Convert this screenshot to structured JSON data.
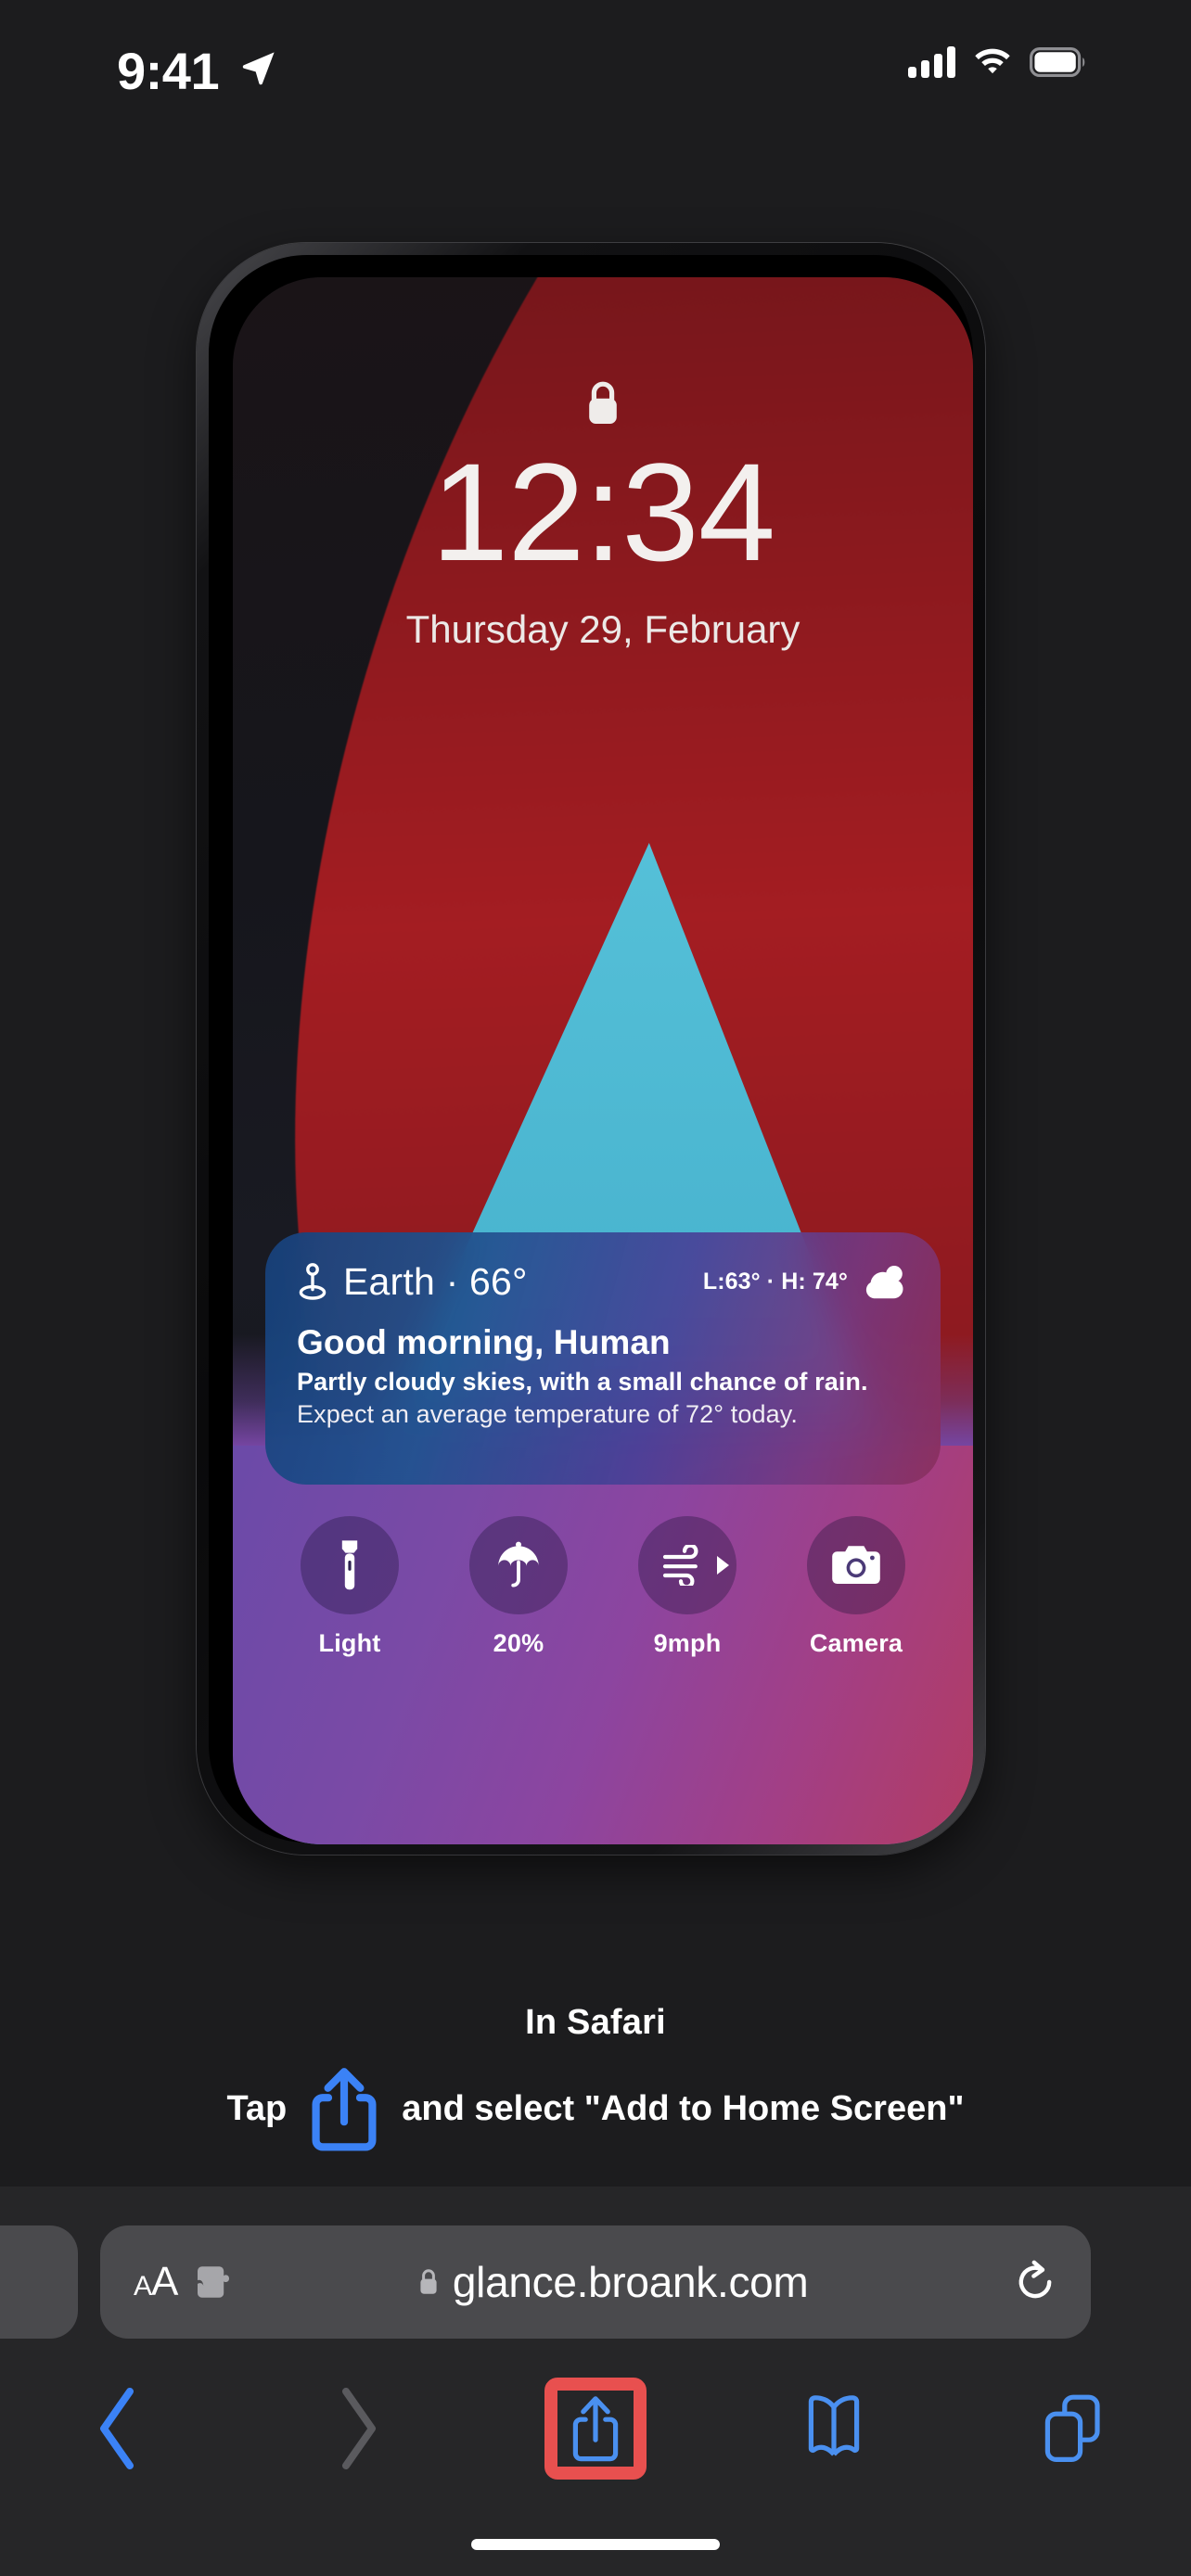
{
  "status_bar": {
    "time": "9:41",
    "location_icon": "location-arrow-icon",
    "signal_icon": "cellular-signal-icon",
    "wifi_icon": "wifi-icon",
    "battery_icon": "battery-full-icon"
  },
  "phone_preview": {
    "lock_icon": "lock-icon",
    "time": "12:34",
    "date": "Thursday 29, February",
    "weather_widget": {
      "location_icon": "location-pin-icon",
      "place_and_temp": "Earth · 66°",
      "high_low": "L:63° · H: 74°",
      "condition_icon": "sun-behind-cloud-icon",
      "greeting": "Good morning, Human",
      "summary": "Partly cloudy skies, with a small chance of rain.",
      "detail": "Expect an average temperature of 72° today."
    },
    "quick_actions": [
      {
        "icon": "flashlight-icon",
        "label": "Light"
      },
      {
        "icon": "umbrella-icon",
        "label": "20%"
      },
      {
        "icon": "wind-icon",
        "label": "9mph",
        "has_arrow": true
      },
      {
        "icon": "camera-icon",
        "label": "Camera"
      }
    ]
  },
  "instructions": {
    "title": "In Safari",
    "before_icon": "Tap",
    "share_icon": "share-icon",
    "after_icon": "and select \"Add to Home Screen\""
  },
  "safari": {
    "text_size_small": "A",
    "text_size_large": "A",
    "extensions_icon": "puzzle-piece-icon",
    "lock_icon": "lock-icon",
    "url": "glance.broank.com",
    "reload_icon": "reload-icon",
    "toolbar": [
      {
        "icon": "back-chevron-icon",
        "enabled": true
      },
      {
        "icon": "forward-chevron-icon",
        "enabled": false
      },
      {
        "icon": "share-icon",
        "highlighted": true
      },
      {
        "icon": "bookmarks-book-icon",
        "enabled": true
      },
      {
        "icon": "tabs-icon",
        "enabled": true
      }
    ],
    "home_indicator": "home-indicator"
  },
  "colors": {
    "page_background": "#1c1c1e",
    "safari_chrome": "#262628",
    "urlbar_fill": "#4a4a4d",
    "accent_blue": "#3b82f6",
    "highlight_red": "#e8504f",
    "disabled_gray": "#5a5a5e"
  }
}
